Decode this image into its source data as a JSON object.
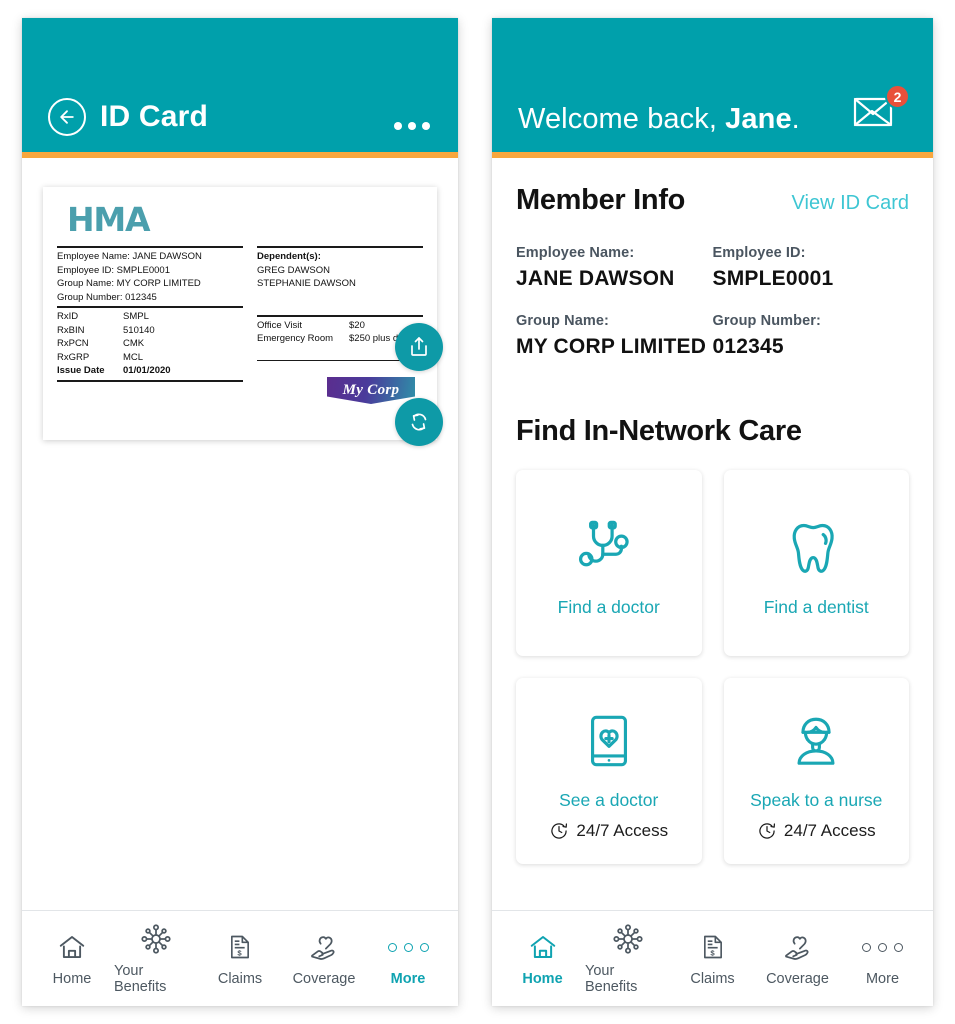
{
  "left_panel": {
    "header": {
      "title": "ID Card",
      "back_icon": "arrow-left-circle-icon",
      "overflow_icon": "more-horizontal-icon"
    },
    "id_card": {
      "brand": "HMA",
      "employee_name_label": "Employee Name:",
      "employee_name_value": "JANE DAWSON",
      "employee_id_label": "Employee ID:",
      "employee_id_value": "SMPLE0001",
      "group_name_label": "Group Name:",
      "group_name_value": "MY CORP LIMITED",
      "group_number_label": "Group Number:",
      "group_number_value": "012345",
      "employee_name_line": "Employee Name: JANE DAWSON",
      "employee_id_line": "Employee ID: SMPLE0001",
      "group_name_line": "Group Name: MY CORP LIMITED",
      "group_number_line": "Group Number: 012345",
      "dependents_heading": "Dependent(s):",
      "dependents": [
        "GREG DAWSON",
        "STEPHANIE DAWSON"
      ],
      "rx_rows": [
        {
          "key": "RxID",
          "value": "SMPL"
        },
        {
          "key": "RxBIN",
          "value": "510140"
        },
        {
          "key": "RxPCN",
          "value": "CMK"
        },
        {
          "key": "RxGRP",
          "value": "MCL"
        },
        {
          "key": "Issue Date",
          "value": "01/01/2020"
        }
      ],
      "benefit_rows": [
        {
          "key": "Office Visit",
          "value": "$20"
        },
        {
          "key": "Emergency Room",
          "value": "$250 plus deductible"
        }
      ],
      "employer_logo_text": "My Corp"
    },
    "fabs": [
      {
        "name": "share-button",
        "icon": "share-upload-icon"
      },
      {
        "name": "flip-card-button",
        "icon": "refresh-flip-icon"
      }
    ],
    "tabbar": {
      "active": "More",
      "items": [
        {
          "label": "Home",
          "icon": "home-icon"
        },
        {
          "label": "Your Benefits",
          "icon": "benefits-network-icon"
        },
        {
          "label": "Claims",
          "icon": "claims-document-dollar-icon"
        },
        {
          "label": "Coverage",
          "icon": "coverage-hand-heart-icon"
        },
        {
          "label": "More",
          "icon": "more-dots-icon"
        }
      ]
    }
  },
  "right_panel": {
    "header": {
      "greeting_prefix": "Welcome back, ",
      "greeting_name": "Jane",
      "greeting_suffix": ".",
      "messages_icon": "envelope-icon",
      "messages_badge": "2"
    },
    "member_info": {
      "title": "Member Info",
      "view_link": "View ID Card",
      "fields": [
        {
          "label": "Employee Name:",
          "value": "JANE DAWSON"
        },
        {
          "label": "Employee ID:",
          "value": "SMPLE0001"
        },
        {
          "label": "Group Name:",
          "value": "MY CORP LIMITED"
        },
        {
          "label": "Group Number:",
          "value": "012345"
        }
      ]
    },
    "find_care": {
      "title": "Find In-Network Care",
      "tiles": [
        {
          "label": "Find a doctor",
          "icon": "stethoscope-icon",
          "sub": ""
        },
        {
          "label": "Find a dentist",
          "icon": "tooth-icon",
          "sub": ""
        },
        {
          "label": "See a doctor",
          "icon": "phone-heart-icon",
          "sub": "24/7 Access",
          "sub_icon": "clock-icon"
        },
        {
          "label": "Speak to a nurse",
          "icon": "nurse-icon",
          "sub": "24/7 Access",
          "sub_icon": "clock-icon"
        }
      ]
    },
    "tabbar": {
      "active": "Home",
      "items": [
        {
          "label": "Home",
          "icon": "home-icon"
        },
        {
          "label": "Your Benefits",
          "icon": "benefits-network-icon"
        },
        {
          "label": "Claims",
          "icon": "claims-document-dollar-icon"
        },
        {
          "label": "Coverage",
          "icon": "coverage-hand-heart-icon"
        },
        {
          "label": "More",
          "icon": "more-dots-icon"
        }
      ]
    }
  },
  "colors": {
    "teal_header": "#00a0ab",
    "orange_rule": "#f9a73e",
    "link_teal": "#3ec6d3",
    "tile_teal": "#1aa7b4",
    "badge_red": "#e8503a",
    "hma_teal": "#4b9fad"
  }
}
